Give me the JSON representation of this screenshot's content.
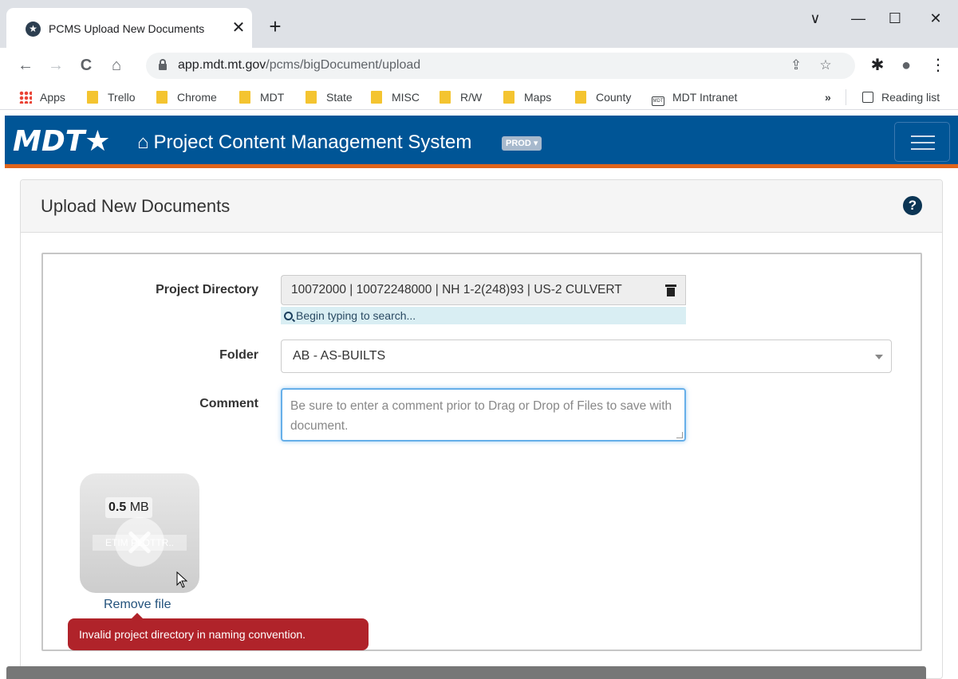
{
  "browser": {
    "tab_title": "PCMS Upload New Documents",
    "tab_close": "✕",
    "new_tab": "+",
    "url_host": "app.mdt.mt.gov",
    "url_path": "/pcms/bigDocument/upload",
    "window_controls": {
      "chevron": "∨",
      "minimize": "—",
      "maximize": "☐",
      "close": "✕"
    },
    "nav": {
      "back": "←",
      "forward": "→",
      "reload": "C",
      "home": "⌂"
    },
    "toolbar_icons": {
      "share": "⇪",
      "star": "☆",
      "extensions": "✱",
      "profile": "●",
      "menu": "⋮"
    }
  },
  "bookmarks": {
    "apps": "Apps",
    "items": [
      "Trello",
      "Chrome",
      "MDT",
      "State",
      "MISC",
      "R/W",
      "Maps",
      "County"
    ],
    "intranet": "MDT Intranet",
    "intranet_badge": "MDT",
    "overflow": "»",
    "reading_list": "Reading list"
  },
  "app": {
    "logo": "MDT★",
    "home_glyph": "⌂",
    "title": "Project Content Management System",
    "env_badge": "PROD ▾"
  },
  "panel": {
    "title": "Upload New Documents",
    "help": "?"
  },
  "form": {
    "project_directory_label": "Project Directory",
    "project_directory_value": "10072000 | 10072248000 | NH 1-2(248)93 | US-2 CULVERT",
    "search_hint": "Begin typing to search...",
    "folder_label": "Folder",
    "folder_value": "AB - AS-BUILTS",
    "comment_label": "Comment",
    "comment_placeholder": "Be sure to enter a comment prior to Drag or Drop of Files to save with document."
  },
  "upload": {
    "size_value": "0.5",
    "size_unit": "MB",
    "filename": "ETIM PLOTTR..",
    "remove_label": "Remove file",
    "error_message": "Invalid project directory in naming convention."
  },
  "colors": {
    "navbar": "#005596",
    "navbar_border": "#e0641b",
    "error": "#b0232a",
    "hint_bg": "#d9eef3"
  }
}
